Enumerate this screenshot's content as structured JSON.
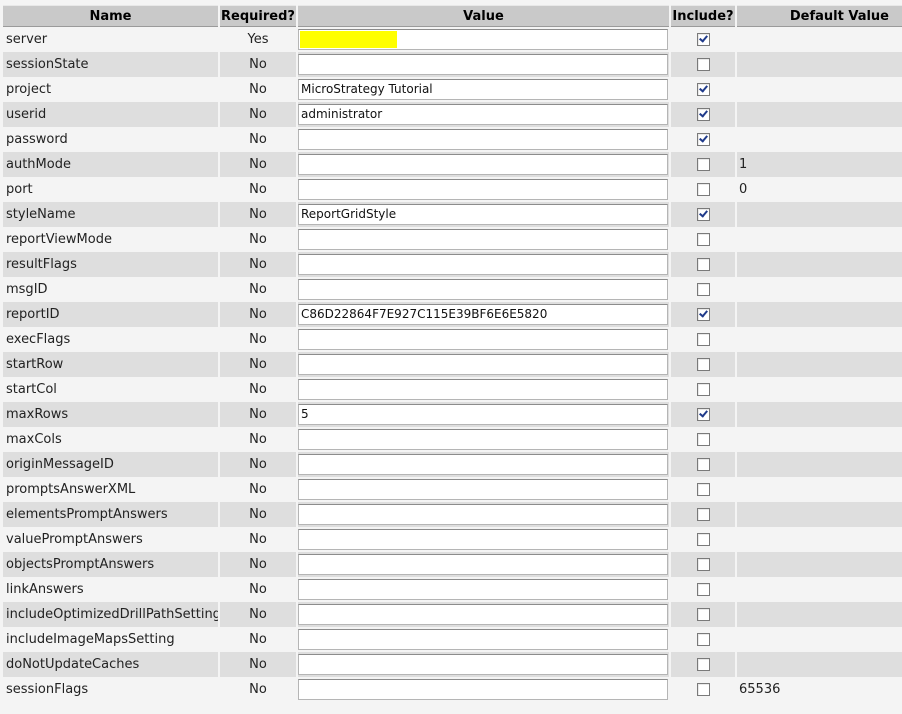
{
  "headers": {
    "name": "Name",
    "required": "Required?",
    "value": "Value",
    "include": "Include?",
    "default": "Default Value"
  },
  "colors": {
    "highlight": "#ffff00",
    "header_bg": "#c9c9c9",
    "row_alt_bg": "#dedede"
  },
  "rows": [
    {
      "name": "server",
      "required": "Yes",
      "value": "",
      "include": true,
      "default": "",
      "highlighted": true
    },
    {
      "name": "sessionState",
      "required": "No",
      "value": "",
      "include": false,
      "default": ""
    },
    {
      "name": "project",
      "required": "No",
      "value": "MicroStrategy Tutorial",
      "include": true,
      "default": ""
    },
    {
      "name": "userid",
      "required": "No",
      "value": "administrator",
      "include": true,
      "default": ""
    },
    {
      "name": "password",
      "required": "No",
      "value": "",
      "include": true,
      "default": ""
    },
    {
      "name": "authMode",
      "required": "No",
      "value": "",
      "include": false,
      "default": "1"
    },
    {
      "name": "port",
      "required": "No",
      "value": "",
      "include": false,
      "default": "0"
    },
    {
      "name": "styleName",
      "required": "No",
      "value": "ReportGridStyle",
      "include": true,
      "default": ""
    },
    {
      "name": "reportViewMode",
      "required": "No",
      "value": "",
      "include": false,
      "default": ""
    },
    {
      "name": "resultFlags",
      "required": "No",
      "value": "",
      "include": false,
      "default": ""
    },
    {
      "name": "msgID",
      "required": "No",
      "value": "",
      "include": false,
      "default": ""
    },
    {
      "name": "reportID",
      "required": "No",
      "value": "C86D22864F7E927C115E39BF6E6E5820",
      "include": true,
      "default": ""
    },
    {
      "name": "execFlags",
      "required": "No",
      "value": "",
      "include": false,
      "default": ""
    },
    {
      "name": "startRow",
      "required": "No",
      "value": "",
      "include": false,
      "default": ""
    },
    {
      "name": "startCol",
      "required": "No",
      "value": "",
      "include": false,
      "default": ""
    },
    {
      "name": "maxRows",
      "required": "No",
      "value": "5",
      "include": true,
      "default": ""
    },
    {
      "name": "maxCols",
      "required": "No",
      "value": "",
      "include": false,
      "default": ""
    },
    {
      "name": "originMessageID",
      "required": "No",
      "value": "",
      "include": false,
      "default": ""
    },
    {
      "name": "promptsAnswerXML",
      "required": "No",
      "value": "",
      "include": false,
      "default": ""
    },
    {
      "name": "elementsPromptAnswers",
      "required": "No",
      "value": "",
      "include": false,
      "default": ""
    },
    {
      "name": "valuePromptAnswers",
      "required": "No",
      "value": "",
      "include": false,
      "default": ""
    },
    {
      "name": "objectsPromptAnswers",
      "required": "No",
      "value": "",
      "include": false,
      "default": ""
    },
    {
      "name": "linkAnswers",
      "required": "No",
      "value": "",
      "include": false,
      "default": ""
    },
    {
      "name": "includeOptimizedDrillPathSetting",
      "required": "No",
      "value": "",
      "include": false,
      "default": ""
    },
    {
      "name": "includeImageMapsSetting",
      "required": "No",
      "value": "",
      "include": false,
      "default": ""
    },
    {
      "name": "doNotUpdateCaches",
      "required": "No",
      "value": "",
      "include": false,
      "default": ""
    },
    {
      "name": "sessionFlags",
      "required": "No",
      "value": "",
      "include": false,
      "default": "65536"
    }
  ]
}
